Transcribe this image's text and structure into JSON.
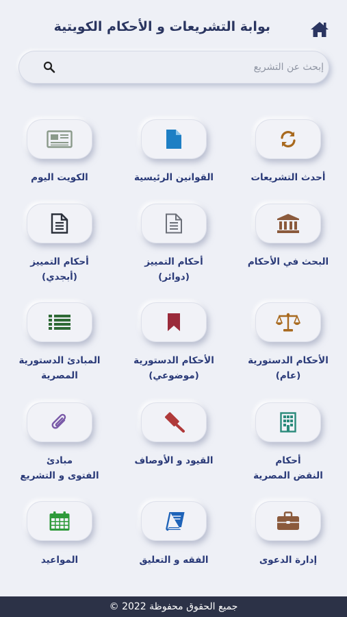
{
  "header": {
    "title": "بوابة التشريعات و الأحكام الكويتية",
    "home_icon": "home-icon"
  },
  "search": {
    "placeholder": "إبحث عن التشريع",
    "icon": "search-icon"
  },
  "tiles": [
    {
      "label_1": "أحدث التشريعات",
      "label_2": "",
      "icon": "refresh-icon",
      "icon_color": "#a8691e"
    },
    {
      "label_1": "القوانين الرئيسية",
      "label_2": "",
      "icon": "document-icon",
      "icon_color": "#1e7fc4"
    },
    {
      "label_1": "الكويت اليوم",
      "label_2": "",
      "icon": "newspaper-icon",
      "icon_color": "#8a9a8a"
    },
    {
      "label_1": "البحث في الأحكام",
      "label_2": "",
      "icon": "courthouse-icon",
      "icon_color": "#8b5a3c"
    },
    {
      "label_1": "أحكام التمييز",
      "label_2": "(دوائر)",
      "icon": "file-text-outline-icon",
      "icon_color": "#6b6f78"
    },
    {
      "label_1": "أحكام التمييز",
      "label_2": "(أبجدي)",
      "icon": "file-text-icon",
      "icon_color": "#2a2f3a"
    },
    {
      "label_1": "الأحكام الدستورية",
      "label_2": "(عام)",
      "icon": "scales-icon",
      "icon_color": "#a8691e"
    },
    {
      "label_1": "الأحكام الدستورية",
      "label_2": "(موضوعي)",
      "icon": "bookmark-icon",
      "icon_color": "#9a2a3a"
    },
    {
      "label_1": "المبادئ الدستورية",
      "label_2": "المصرية",
      "icon": "list-icon",
      "icon_color": "#2e6a35"
    },
    {
      "label_1": "أحكام",
      "label_2": "النقض المصرية",
      "icon": "building-icon",
      "icon_color": "#2a8a7a"
    },
    {
      "label_1": "القيود و الأوصاف",
      "label_2": "",
      "icon": "gavel-icon",
      "icon_color": "#b03a3a"
    },
    {
      "label_1": "مبادئ",
      "label_2": "الفتوى و التشريع",
      "icon": "paperclip-icon",
      "icon_color": "#7a5aa8"
    },
    {
      "label_1": "إدارة الدعوى",
      "label_2": "",
      "icon": "briefcase-icon",
      "icon_color": "#8b5a3c"
    },
    {
      "label_1": "الفقه و التعليق",
      "label_2": "",
      "icon": "book-icon",
      "icon_color": "#1e63b8"
    },
    {
      "label_1": "المواعيد",
      "label_2": "",
      "icon": "calendar-icon",
      "icon_color": "#2e9a3a"
    }
  ],
  "footer": {
    "text": "جميع الحقوق محفوظة 2022 ©"
  }
}
